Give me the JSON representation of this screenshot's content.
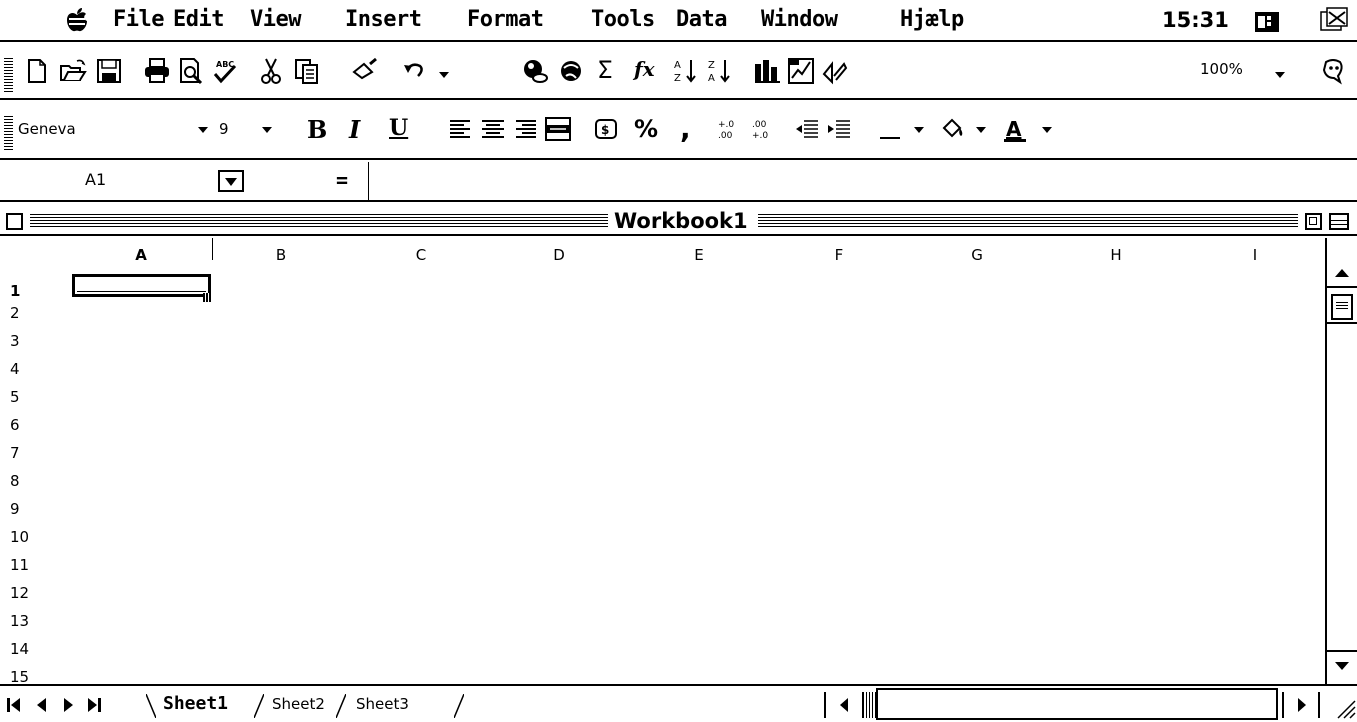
{
  "menubar": {
    "apple_icon": "apple-menu-icon",
    "items": [
      "File",
      "Edit",
      "View",
      "Insert",
      "Format",
      "Tools",
      "Data",
      "Window",
      "Hjælp"
    ],
    "clock": "15:31",
    "app_icon": "excel-app-icon",
    "switcher_icon": "application-switcher-icon"
  },
  "standard_toolbar": {
    "icons": [
      "new-document-icon",
      "open-folder-icon",
      "save-disk-icon",
      "print-icon",
      "print-preview-icon",
      "spelling-icon",
      "cut-scissors-icon",
      "copy-icon",
      "format-painter-icon",
      "undo-icon",
      "web-link-icon",
      "web-toolbar-icon",
      "autosum-icon",
      "function-icon",
      "sort-ascending-icon",
      "sort-descending-icon",
      "chart-wizard-icon",
      "map-icon",
      "drawing-icon",
      "office-assistant-icon"
    ],
    "sum_glyph": "Σ",
    "fx_glyph": "fx",
    "zoom": "100%"
  },
  "formatting_toolbar": {
    "font_name": "Geneva",
    "font_size": "9",
    "bold": "B",
    "italic": "I",
    "underline": "U",
    "percent": "%",
    "comma": ",",
    "icons": [
      "align-left-icon",
      "align-center-icon",
      "align-right-icon",
      "merge-center-icon",
      "currency-icon",
      "increase-decimal-icon",
      "decrease-decimal-icon",
      "decrease-indent-icon",
      "increase-indent-icon",
      "borders-icon",
      "fill-color-icon",
      "font-color-icon"
    ]
  },
  "formula_bar": {
    "name_box": "A1",
    "equals": "="
  },
  "workbook": {
    "title": "Workbook1",
    "columns": [
      "A",
      "B",
      "C",
      "D",
      "E",
      "F",
      "G",
      "H",
      "I"
    ],
    "rows": [
      "1",
      "2",
      "3",
      "4",
      "5",
      "6",
      "7",
      "8",
      "9",
      "10",
      "11",
      "12",
      "13",
      "14",
      "15"
    ],
    "active_cell": "A1"
  },
  "sheets": [
    "Sheet1",
    "Sheet2",
    "Sheet3"
  ],
  "active_sheet": "Sheet1"
}
